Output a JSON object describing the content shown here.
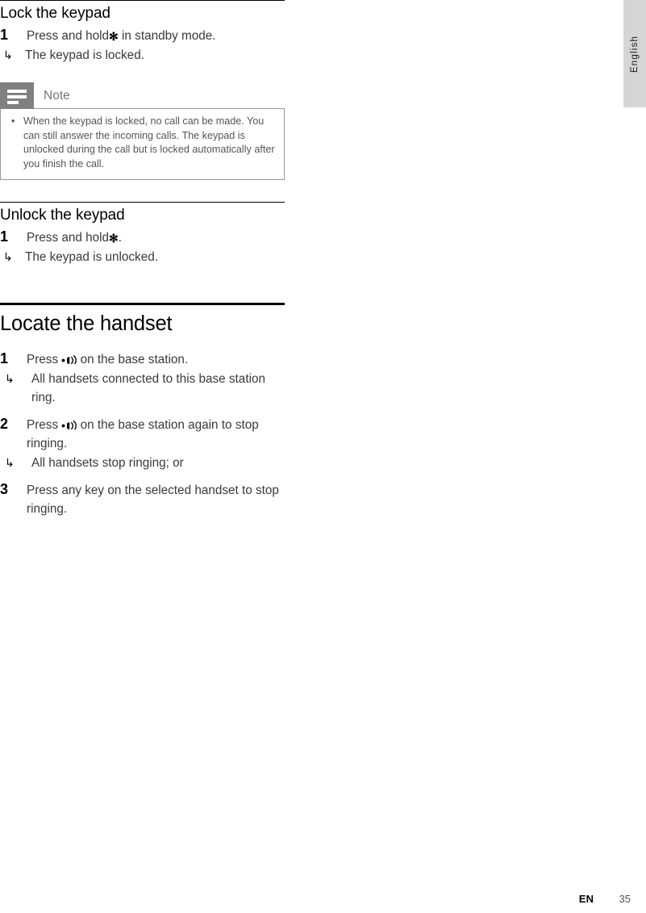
{
  "page": {
    "language_tab": "English",
    "footer_language_code": "EN",
    "footer_page_number": "35",
    "colors": {
      "note_icon_bg": "#808080",
      "note_border": "#999999",
      "note_text": "#555555",
      "body_text": "#3a3a3a",
      "tab_bg": "#d5d5d5",
      "rule": "#000000"
    }
  },
  "sections": [
    {
      "title": "Lock the keypad",
      "steps": [
        {
          "number": "1",
          "text_before": "Press and hold",
          "icon": "star-key-icon",
          "text_after": "in standby mode.",
          "results": [
            "The keypad is locked."
          ]
        }
      ],
      "note": {
        "label": "Note",
        "icon": "note-lines-icon",
        "items": [
          "When the keypad is locked, no call can be made. You can still answer the incoming calls. The keypad is unlocked during the call but is locked automatically after you finish the call."
        ]
      }
    },
    {
      "title": "Unlock the keypad",
      "steps": [
        {
          "number": "1",
          "text_before": "Press and hold",
          "icon": "star-key-icon",
          "text_after": ".",
          "results": [
            "The keypad is unlocked."
          ]
        }
      ]
    }
  ],
  "chapter": {
    "title": "Locate the handset",
    "steps": [
      {
        "number": "1",
        "text_before": "Press",
        "icon": "paging-key-icon",
        "text_after": "on the base station.",
        "results": [
          "All handsets connected to this base station ring."
        ]
      },
      {
        "number": "2",
        "text_before": "Press",
        "icon": "paging-key-icon",
        "text_after": "on the base station again to stop ringing.",
        "results": [
          "All handsets stop ringing; or"
        ]
      },
      {
        "number": "3",
        "text_before": "Press any key on the selected handset to stop ringing.",
        "icon": "",
        "text_after": "",
        "results": []
      }
    ]
  },
  "glyphs": {
    "result_arrow": "↳",
    "bullet": "•",
    "star_key": "✻"
  }
}
